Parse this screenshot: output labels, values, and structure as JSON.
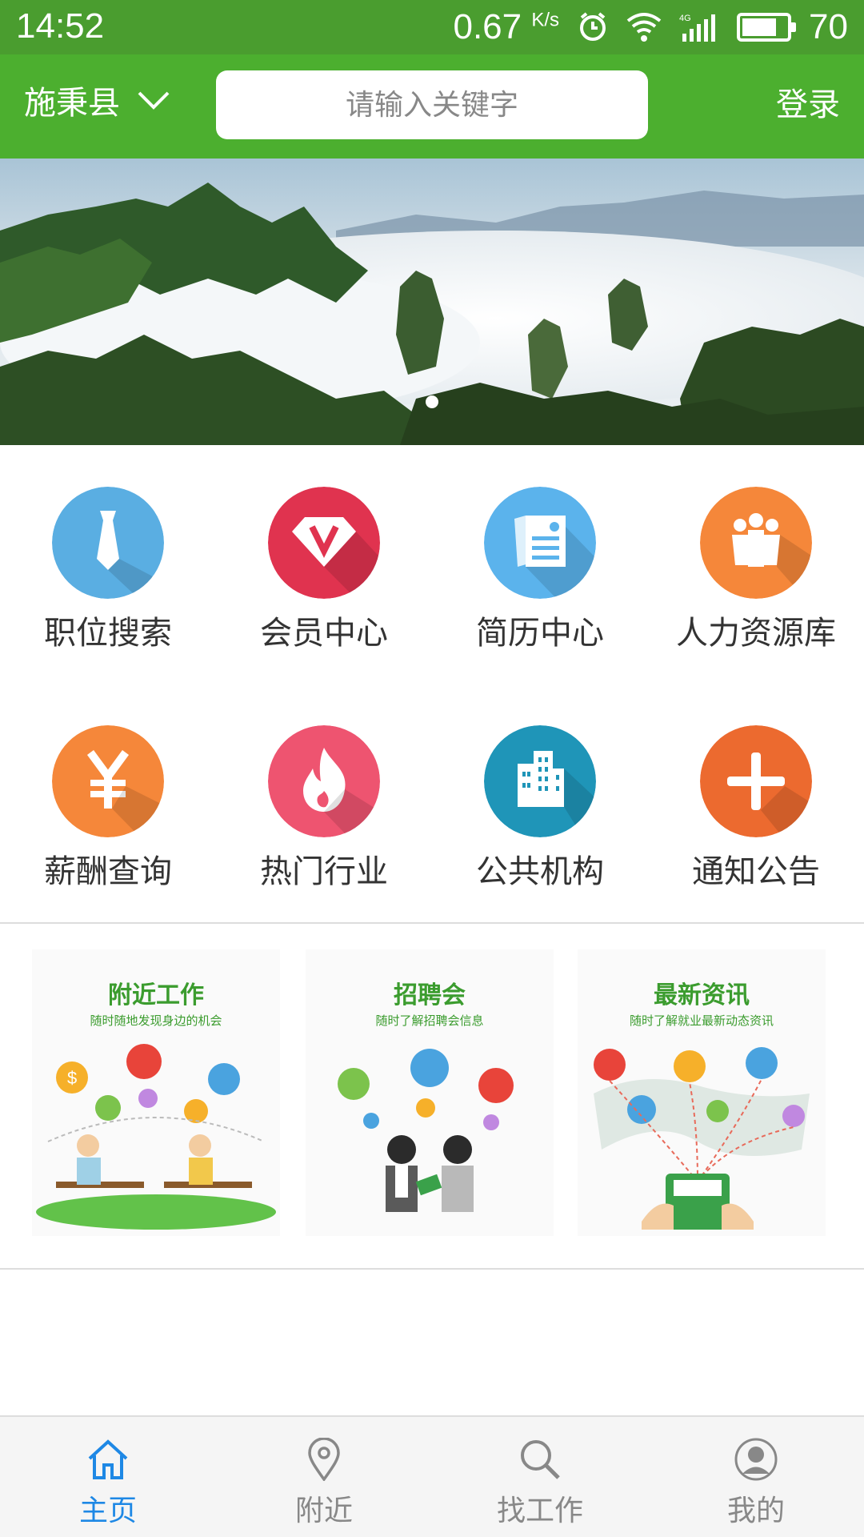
{
  "status_bar": {
    "time": "14:52",
    "speed": "0.67",
    "speed_unit": "K/s",
    "battery": "70"
  },
  "header": {
    "location": "施秉县",
    "search_placeholder": "请输入关键字",
    "login": "登录"
  },
  "grid": [
    {
      "label": "职位搜索",
      "icon": "tie-icon",
      "color": "#5aaee2"
    },
    {
      "label": "会员中心",
      "icon": "vip-diamond-icon",
      "color": "#e0334f"
    },
    {
      "label": "简历中心",
      "icon": "resume-icon",
      "color": "#5bb3ec"
    },
    {
      "label": "人力资源库",
      "icon": "people-icon",
      "color": "#f5873a"
    },
    {
      "label": "薪酬查询",
      "icon": "yen-icon",
      "color": "#f5873a"
    },
    {
      "label": "热门行业",
      "icon": "fire-icon",
      "color": "#ee5470"
    },
    {
      "label": "公共机构",
      "icon": "building-icon",
      "color": "#1f95b8"
    },
    {
      "label": "通知公告",
      "icon": "plus-icon",
      "color": "#ec6a2f"
    }
  ],
  "promos": [
    {
      "title": "附近工作",
      "subtitle": "随时随地发现身边的机会"
    },
    {
      "title": "招聘会",
      "subtitle": "随时了解招聘会信息"
    },
    {
      "title": "最新资讯",
      "subtitle": "随时了解就业最新动态资讯"
    }
  ],
  "tabs": [
    {
      "label": "主页",
      "icon": "home-icon",
      "active": true
    },
    {
      "label": "附近",
      "icon": "location-pin-icon",
      "active": false
    },
    {
      "label": "找工作",
      "icon": "search-icon",
      "active": false
    },
    {
      "label": "我的",
      "icon": "user-icon",
      "active": false
    }
  ],
  "colors": {
    "status_bar": "#4a9d2f",
    "header": "#4caf2f",
    "active_tab": "#1e88e5"
  }
}
